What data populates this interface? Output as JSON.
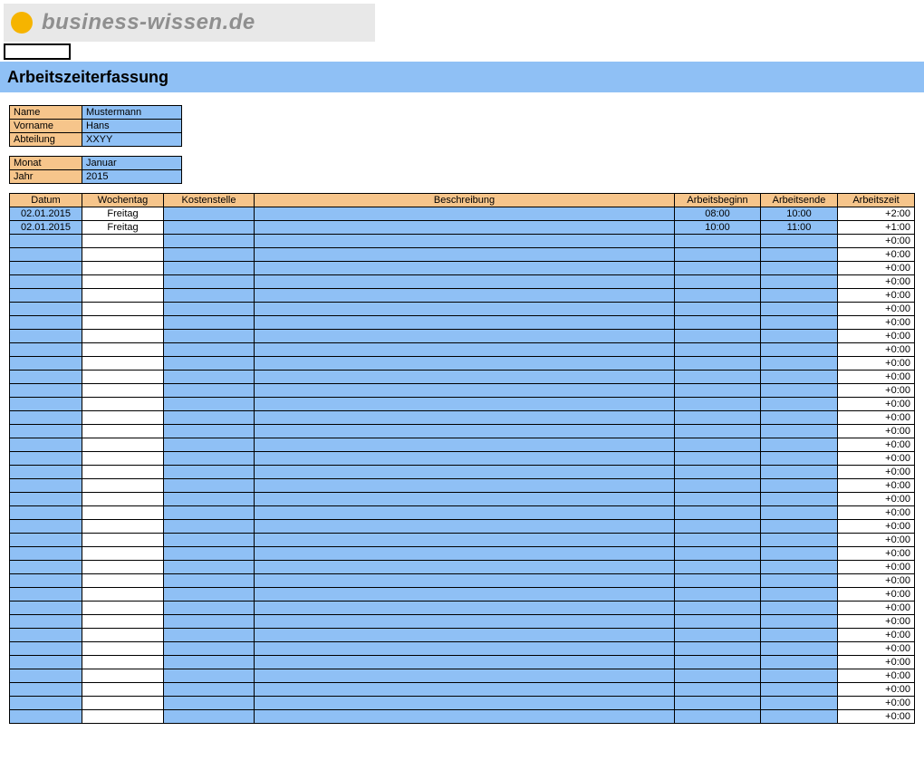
{
  "logo": {
    "text": "business-wissen.de"
  },
  "title": "Arbeitszeiterfassung",
  "meta1": [
    {
      "label": "Name",
      "value": "Mustermann"
    },
    {
      "label": "Vorname",
      "value": "Hans"
    },
    {
      "label": "Abteilung",
      "value": "XXYY"
    }
  ],
  "meta2": [
    {
      "label": "Monat",
      "value": "Januar"
    },
    {
      "label": "Jahr",
      "value": "2015"
    }
  ],
  "columns": {
    "datum": "Datum",
    "wochentag": "Wochentag",
    "kostenstelle": "Kostenstelle",
    "beschreibung": "Beschreibung",
    "arbeitsbeginn": "Arbeitsbeginn",
    "arbeitsende": "Arbeitsende",
    "arbeitszeit": "Arbeitszeit"
  },
  "rows": [
    {
      "datum": "02.01.2015",
      "wochentag": "Freitag",
      "kostenstelle": "",
      "beschreibung": "",
      "beginn": "08:00",
      "ende": "10:00",
      "zeit": "+2:00"
    },
    {
      "datum": "02.01.2015",
      "wochentag": "Freitag",
      "kostenstelle": "",
      "beschreibung": "",
      "beginn": "10:00",
      "ende": "11:00",
      "zeit": "+1:00"
    },
    {
      "datum": "",
      "wochentag": "",
      "kostenstelle": "",
      "beschreibung": "",
      "beginn": "",
      "ende": "",
      "zeit": "+0:00"
    },
    {
      "datum": "",
      "wochentag": "",
      "kostenstelle": "",
      "beschreibung": "",
      "beginn": "",
      "ende": "",
      "zeit": "+0:00"
    },
    {
      "datum": "",
      "wochentag": "",
      "kostenstelle": "",
      "beschreibung": "",
      "beginn": "",
      "ende": "",
      "zeit": "+0:00"
    },
    {
      "datum": "",
      "wochentag": "",
      "kostenstelle": "",
      "beschreibung": "",
      "beginn": "",
      "ende": "",
      "zeit": "+0:00"
    },
    {
      "datum": "",
      "wochentag": "",
      "kostenstelle": "",
      "beschreibung": "",
      "beginn": "",
      "ende": "",
      "zeit": "+0:00"
    },
    {
      "datum": "",
      "wochentag": "",
      "kostenstelle": "",
      "beschreibung": "",
      "beginn": "",
      "ende": "",
      "zeit": "+0:00"
    },
    {
      "datum": "",
      "wochentag": "",
      "kostenstelle": "",
      "beschreibung": "",
      "beginn": "",
      "ende": "",
      "zeit": "+0:00"
    },
    {
      "datum": "",
      "wochentag": "",
      "kostenstelle": "",
      "beschreibung": "",
      "beginn": "",
      "ende": "",
      "zeit": "+0:00"
    },
    {
      "datum": "",
      "wochentag": "",
      "kostenstelle": "",
      "beschreibung": "",
      "beginn": "",
      "ende": "",
      "zeit": "+0:00"
    },
    {
      "datum": "",
      "wochentag": "",
      "kostenstelle": "",
      "beschreibung": "",
      "beginn": "",
      "ende": "",
      "zeit": "+0:00"
    },
    {
      "datum": "",
      "wochentag": "",
      "kostenstelle": "",
      "beschreibung": "",
      "beginn": "",
      "ende": "",
      "zeit": "+0:00"
    },
    {
      "datum": "",
      "wochentag": "",
      "kostenstelle": "",
      "beschreibung": "",
      "beginn": "",
      "ende": "",
      "zeit": "+0:00"
    },
    {
      "datum": "",
      "wochentag": "",
      "kostenstelle": "",
      "beschreibung": "",
      "beginn": "",
      "ende": "",
      "zeit": "+0:00"
    },
    {
      "datum": "",
      "wochentag": "",
      "kostenstelle": "",
      "beschreibung": "",
      "beginn": "",
      "ende": "",
      "zeit": "+0:00"
    },
    {
      "datum": "",
      "wochentag": "",
      "kostenstelle": "",
      "beschreibung": "",
      "beginn": "",
      "ende": "",
      "zeit": "+0:00"
    },
    {
      "datum": "",
      "wochentag": "",
      "kostenstelle": "",
      "beschreibung": "",
      "beginn": "",
      "ende": "",
      "zeit": "+0:00"
    },
    {
      "datum": "",
      "wochentag": "",
      "kostenstelle": "",
      "beschreibung": "",
      "beginn": "",
      "ende": "",
      "zeit": "+0:00"
    },
    {
      "datum": "",
      "wochentag": "",
      "kostenstelle": "",
      "beschreibung": "",
      "beginn": "",
      "ende": "",
      "zeit": "+0:00"
    },
    {
      "datum": "",
      "wochentag": "",
      "kostenstelle": "",
      "beschreibung": "",
      "beginn": "",
      "ende": "",
      "zeit": "+0:00"
    },
    {
      "datum": "",
      "wochentag": "",
      "kostenstelle": "",
      "beschreibung": "",
      "beginn": "",
      "ende": "",
      "zeit": "+0:00"
    },
    {
      "datum": "",
      "wochentag": "",
      "kostenstelle": "",
      "beschreibung": "",
      "beginn": "",
      "ende": "",
      "zeit": "+0:00"
    },
    {
      "datum": "",
      "wochentag": "",
      "kostenstelle": "",
      "beschreibung": "",
      "beginn": "",
      "ende": "",
      "zeit": "+0:00"
    },
    {
      "datum": "",
      "wochentag": "",
      "kostenstelle": "",
      "beschreibung": "",
      "beginn": "",
      "ende": "",
      "zeit": "+0:00"
    },
    {
      "datum": "",
      "wochentag": "",
      "kostenstelle": "",
      "beschreibung": "",
      "beginn": "",
      "ende": "",
      "zeit": "+0:00"
    },
    {
      "datum": "",
      "wochentag": "",
      "kostenstelle": "",
      "beschreibung": "",
      "beginn": "",
      "ende": "",
      "zeit": "+0:00"
    },
    {
      "datum": "",
      "wochentag": "",
      "kostenstelle": "",
      "beschreibung": "",
      "beginn": "",
      "ende": "",
      "zeit": "+0:00"
    },
    {
      "datum": "",
      "wochentag": "",
      "kostenstelle": "",
      "beschreibung": "",
      "beginn": "",
      "ende": "",
      "zeit": "+0:00"
    },
    {
      "datum": "",
      "wochentag": "",
      "kostenstelle": "",
      "beschreibung": "",
      "beginn": "",
      "ende": "",
      "zeit": "+0:00"
    },
    {
      "datum": "",
      "wochentag": "",
      "kostenstelle": "",
      "beschreibung": "",
      "beginn": "",
      "ende": "",
      "zeit": "+0:00"
    },
    {
      "datum": "",
      "wochentag": "",
      "kostenstelle": "",
      "beschreibung": "",
      "beginn": "",
      "ende": "",
      "zeit": "+0:00"
    },
    {
      "datum": "",
      "wochentag": "",
      "kostenstelle": "",
      "beschreibung": "",
      "beginn": "",
      "ende": "",
      "zeit": "+0:00"
    },
    {
      "datum": "",
      "wochentag": "",
      "kostenstelle": "",
      "beschreibung": "",
      "beginn": "",
      "ende": "",
      "zeit": "+0:00"
    },
    {
      "datum": "",
      "wochentag": "",
      "kostenstelle": "",
      "beschreibung": "",
      "beginn": "",
      "ende": "",
      "zeit": "+0:00"
    },
    {
      "datum": "",
      "wochentag": "",
      "kostenstelle": "",
      "beschreibung": "",
      "beginn": "",
      "ende": "",
      "zeit": "+0:00"
    },
    {
      "datum": "",
      "wochentag": "",
      "kostenstelle": "",
      "beschreibung": "",
      "beginn": "",
      "ende": "",
      "zeit": "+0:00"
    },
    {
      "datum": "",
      "wochentag": "",
      "kostenstelle": "",
      "beschreibung": "",
      "beginn": "",
      "ende": "",
      "zeit": "+0:00"
    }
  ]
}
